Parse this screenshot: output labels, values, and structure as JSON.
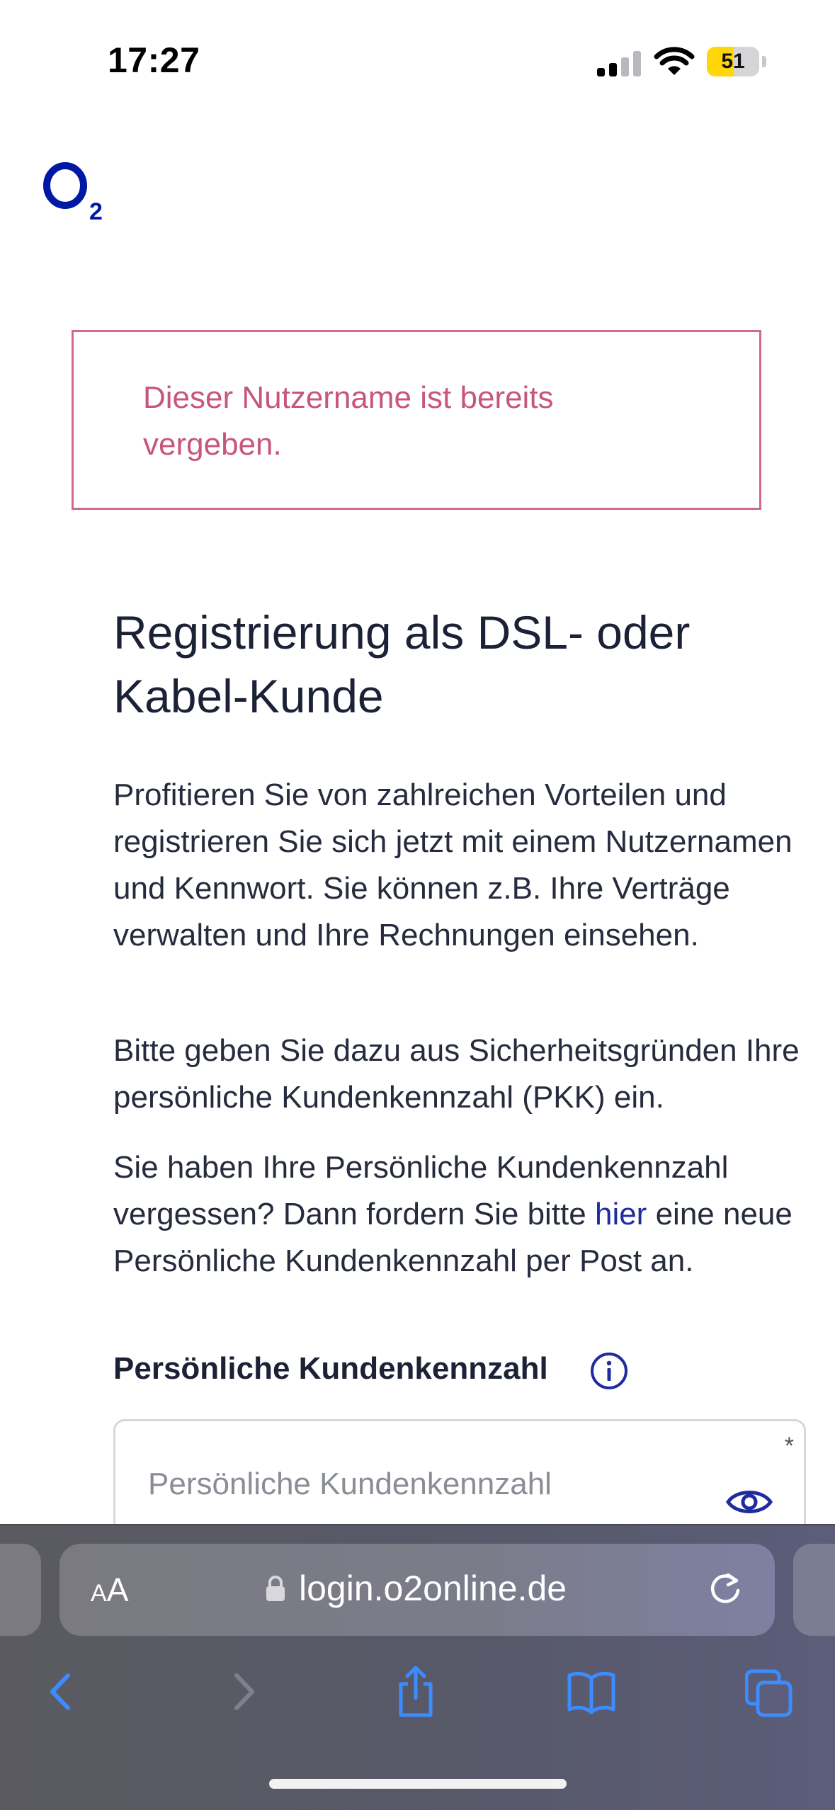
{
  "status_bar": {
    "time": "17:27",
    "battery_level": "51",
    "battery_fraction": 0.51,
    "icons": [
      "signal-icon",
      "wifi-icon",
      "battery-icon"
    ]
  },
  "brand": {
    "logo_icon": "o2-logo",
    "color": "#0019a5"
  },
  "alert": {
    "message": "Dieser Nutzername ist bereits vergeben.",
    "border_color": "#d46a8a",
    "text_color": "#c85679"
  },
  "content": {
    "title": "Registrierung als DSL- oder Kabel-Kunde",
    "paragraph1": "Profitieren Sie von zahlreichen Vorteilen und registrieren Sie sich jetzt mit einem Nutzernamen und Kennwort. Sie können z.B. Ihre Verträge verwalten und Ihre Rechnungen einsehen.",
    "paragraph2": "Bitte geben Sie dazu aus Sicherheitsgründen Ihre persönliche Kundenkennzahl (PKK) ein.",
    "paragraph3_before": "Sie haben Ihre Persönliche Kundenkennzahl vergessen? Dann fordern Sie bitte ",
    "paragraph3_link": "hier",
    "paragraph3_after": " eine neue Persönliche Kundenkennzahl per Post an.",
    "link_color": "#1f2b9f"
  },
  "form": {
    "pkk_label": "Persönliche Kundenkennzahl",
    "pkk_placeholder": "Persönliche Kundenkennzahl",
    "pkk_value": "",
    "required_marker": "*",
    "info_icon": "info-icon",
    "toggle_icon": "eye-icon"
  },
  "browser": {
    "aa_label_small": "A",
    "aa_label_large": "A",
    "url": "login.o2online.de",
    "icons": [
      "lock-icon",
      "reload-icon",
      "back-icon",
      "forward-icon",
      "share-icon",
      "bookmarks-icon",
      "tabs-icon"
    ],
    "accent_color": "#3d8cff"
  }
}
